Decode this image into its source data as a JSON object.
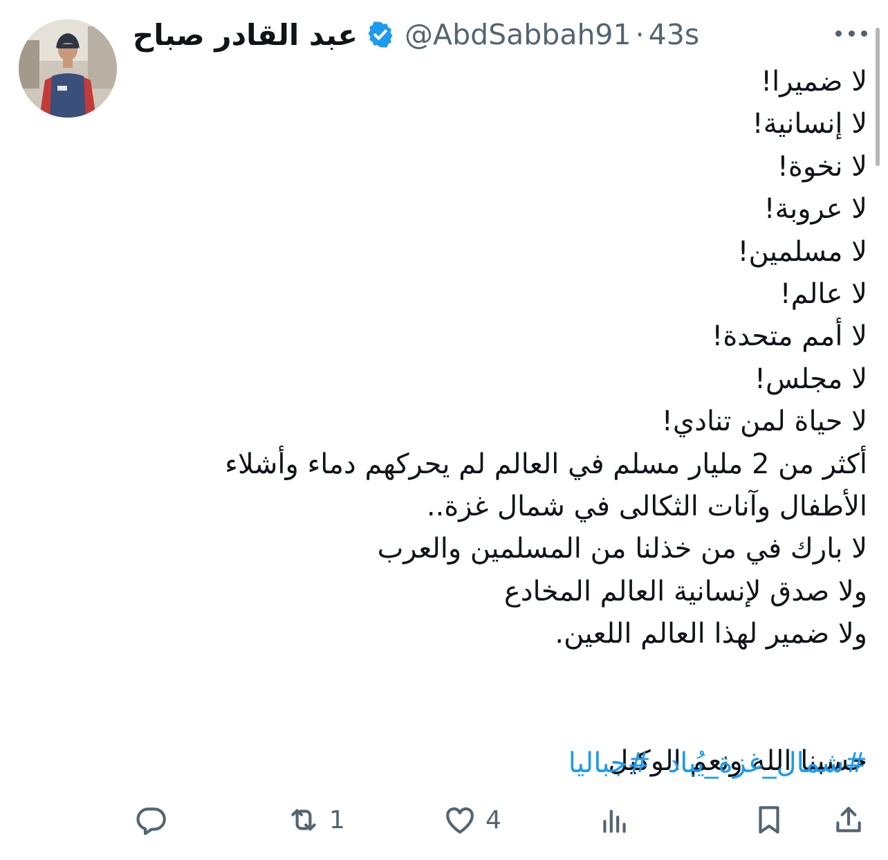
{
  "tweet": {
    "display_name": "عبد القادر صباح",
    "handle": "@AbdSabbah91",
    "separator": "·",
    "time": "43s",
    "verified": true,
    "lines": [
      "لا ضميرا!",
      "لا إنسانية!",
      "لا نخوة!",
      "لا عروبة!",
      "لا مسلمين!",
      "لا عالم!",
      "لا أمم متحدة!",
      "لا مجلس!",
      "لا حياة لمن تنادي!",
      "أكثر من 2 مليار مسلم في العالم لم يحركهم دماء وأشلاء",
      "الأطفال وآنات الثكالى في شمال غزة..",
      "لا بارك في من خذلنا من المسلمين والعرب",
      "ولا صدق لإنسانية العالم المخادع",
      "ولا ضمير لهذا العالم اللعين."
    ],
    "closing_line": "حسبنا الله ونعم الوكيل",
    "hashtags": [
      "#شمال_غزة_يُباد",
      "#جباليا"
    ]
  },
  "actions": {
    "reply": {
      "icon": "reply-icon",
      "count": ""
    },
    "retweet": {
      "icon": "retweet-icon",
      "count": "1"
    },
    "like": {
      "icon": "heart-icon",
      "count": "4"
    },
    "views": {
      "icon": "views-icon",
      "count": ""
    },
    "bookmark": {
      "icon": "bookmark-icon"
    },
    "share": {
      "icon": "share-icon"
    }
  },
  "colors": {
    "text": "#0f1419",
    "secondary": "#536471",
    "link": "#1d9bf0",
    "verified": "#1d9bf0"
  }
}
